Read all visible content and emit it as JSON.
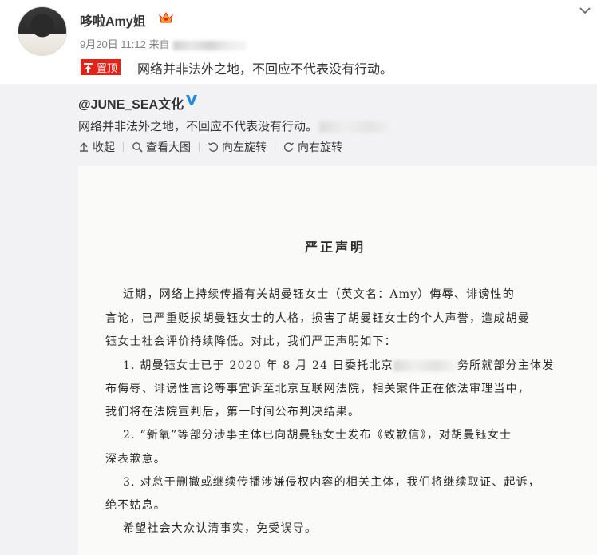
{
  "post": {
    "username": "哆啦Amy姐",
    "timestamp": "9月20日 11:12",
    "source_prefix": "来自",
    "pin_label": "置顶",
    "text": "网络并非法外之地，不回应不代表没有行动。"
  },
  "repost": {
    "author": "@JUNE_SEA文化",
    "text": "网络并非法外之地，不回应不代表没有行动。",
    "toolbar": {
      "collapse": "收起",
      "view_large": "查看大图",
      "rotate_left": "向左旋转",
      "rotate_right": "向右旋转"
    }
  },
  "document": {
    "title": "严正声明",
    "lines": [
      "近期，网络上持续传播有关胡曼钰女士（英文名：Amy）侮辱、诽谤性的",
      "言论，已严重贬损胡曼钰女士的人格，损害了胡曼钰女士的个人声誉，造成胡曼",
      "钰女士社会评价持续降低。对此，我们严正声明如下：",
      "1. 胡曼钰女士已于 2020 年 8 月 24 日委托北京",
      "务所就部分主体发",
      "布侮辱、诽谤性言论等事宜诉至北京互联网法院，相关案件正在依法审理当中，",
      "我们将在法院宣判后，第一时间公布判决结果。",
      "2. “新氧”等部分涉事主体已向胡曼钰女士发布《致歉信》，对胡曼钰女士",
      "深表歉意。",
      "3. 对怠于删撤或继续传播涉嫌侵权内容的相关主体，我们将继续取证、起诉，",
      "绝不姑息。",
      "希望社会大众认清事实，免受误导。"
    ]
  },
  "colors": {
    "pin_red": "#e2231a",
    "verified_blue": "#1f8ae0",
    "repost_bg": "#f2f2f5"
  },
  "icons": [
    "chevron-down-icon",
    "vip-crown-icon",
    "pin-icon",
    "verified-icon",
    "collapse-icon",
    "search-icon",
    "rotate-left-icon",
    "rotate-right-icon"
  ]
}
